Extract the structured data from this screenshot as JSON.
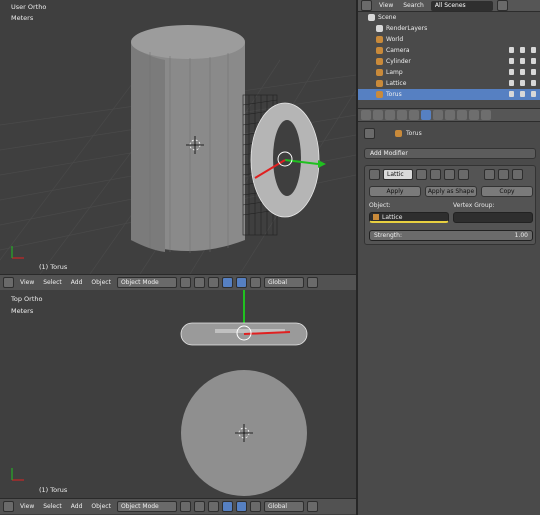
{
  "top_view": {
    "title": "User Ortho",
    "units": "Meters",
    "selection": "(1) Torus"
  },
  "bottom_view": {
    "title": "Top Ortho",
    "units": "Meters",
    "selection": "(1) Torus"
  },
  "header_menu": {
    "view": "View",
    "select": "Select",
    "add": "Add",
    "object": "Object",
    "mode": "Object Mode",
    "orientation": "Global"
  },
  "outliner": {
    "view": "View",
    "search": "Search",
    "display": "All Scenes",
    "items": [
      {
        "label": "Scene",
        "icon_color": "#d8d8d8"
      },
      {
        "label": "RenderLayers",
        "icon_color": "#d8d8d8"
      },
      {
        "label": "World",
        "icon_color": "#c98a3a"
      },
      {
        "label": "Camera",
        "icon_color": "#c98a3a"
      },
      {
        "label": "Cylinder",
        "icon_color": "#c98a3a"
      },
      {
        "label": "Lamp",
        "icon_color": "#c98a3a"
      },
      {
        "label": "Lattice",
        "icon_color": "#c98a3a"
      },
      {
        "label": "Torus",
        "icon_color": "#c98a3a"
      }
    ]
  },
  "properties": {
    "context": "Torus",
    "add_modifier": "Add Modifier",
    "modifier_name": "Lattic",
    "apply": "Apply",
    "apply_shape": "Apply as Shape",
    "copy": "Copy",
    "object_label": "Object:",
    "object_value": "Lattice",
    "vgroup_label": "Vertex Group:",
    "strength_label": "Strength:",
    "strength_value": "1.00"
  },
  "colors": {
    "accent": "#5680c2",
    "x_axis": "#e02020",
    "y_axis": "#20c020",
    "highlight": "#e8d040"
  }
}
